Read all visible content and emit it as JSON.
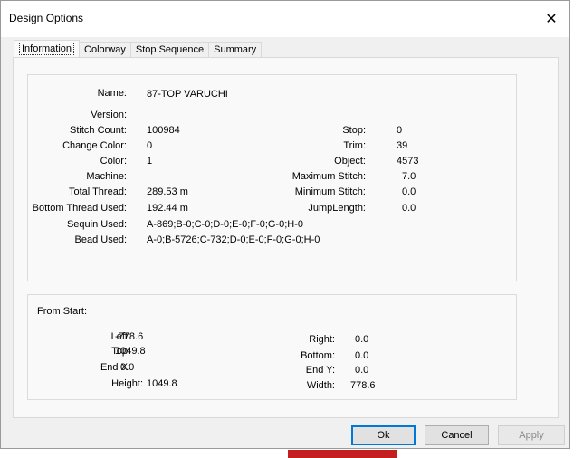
{
  "window": {
    "title": "Design Options"
  },
  "tabs": [
    "Information",
    "Colorway",
    "Stop Sequence",
    "Summary"
  ],
  "info": {
    "left": [
      {
        "label": "Name:",
        "value": "87-TOP VARUCHI"
      },
      {
        "label": "Version:",
        "value": ""
      },
      {
        "label": "Stitch Count:",
        "value": "100984"
      },
      {
        "label": "Change Color:",
        "value": "0"
      },
      {
        "label": "Color:",
        "value": "1"
      },
      {
        "label": "Machine:",
        "value": ""
      },
      {
        "label": "Total Thread:",
        "value": "289.53 m"
      },
      {
        "label": "Bottom Thread Used:",
        "value": "192.44 m"
      },
      {
        "label": "Sequin Used:",
        "value": "A-869;B-0;C-0;D-0;E-0;F-0;G-0;H-0"
      },
      {
        "label": "Bead Used:",
        "value": "A-0;B-5726;C-732;D-0;E-0;F-0;G-0;H-0"
      }
    ],
    "right": [
      {
        "label": "Stop:",
        "value": "0"
      },
      {
        "label": "Trim:",
        "value": "39"
      },
      {
        "label": "Object:",
        "value": "4573"
      },
      {
        "label": "Maximum Stitch:",
        "value": "7.0"
      },
      {
        "label": "Minimum Stitch:",
        "value": "0.0"
      },
      {
        "label": "JumpLength:",
        "value": "0.0"
      }
    ]
  },
  "from_start": {
    "title": "From Start:",
    "left": [
      {
        "label": "Left:",
        "value": "-778.6"
      },
      {
        "label": "Top:",
        "value": "1049.8"
      },
      {
        "label": "End X:",
        "value": "0.0"
      },
      {
        "label": "Height:",
        "value": "1049.8"
      }
    ],
    "right": [
      {
        "label": "Right:",
        "value": "0.0"
      },
      {
        "label": "Bottom:",
        "value": "0.0"
      },
      {
        "label": "End Y:",
        "value": "0.0"
      },
      {
        "label": "Width:",
        "value": "778.6"
      }
    ]
  },
  "buttons": {
    "ok": "Ok",
    "cancel": "Cancel",
    "apply": "Apply"
  }
}
